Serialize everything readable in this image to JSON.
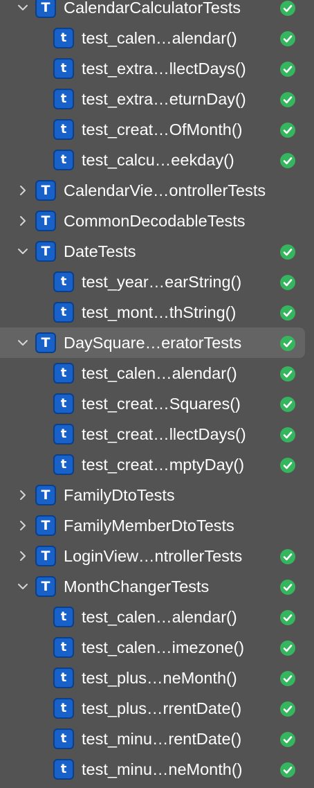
{
  "colors": {
    "background": "#535353",
    "selected_row": "#646464",
    "badge_fill": "#1761c9",
    "pass_green": "#36b55f"
  },
  "items": [
    {
      "kind": "case",
      "label": "CalendarCalculatorTests",
      "expanded": true,
      "passed": true
    },
    {
      "kind": "method",
      "label": "test_calen…alendar()",
      "passed": true
    },
    {
      "kind": "method",
      "label": "test_extra…llectDays()",
      "passed": true
    },
    {
      "kind": "method",
      "label": "test_extra…eturnDay()",
      "passed": true
    },
    {
      "kind": "method",
      "label": "test_creat…OfMonth()",
      "passed": true
    },
    {
      "kind": "method",
      "label": "test_calcu…eekday()",
      "passed": true
    },
    {
      "kind": "case",
      "label": "CalendarVie…ontrollerTests",
      "expanded": false,
      "passed": false
    },
    {
      "kind": "case",
      "label": "CommonDecodableTests",
      "expanded": false,
      "passed": false
    },
    {
      "kind": "case",
      "label": "DateTests",
      "expanded": true,
      "passed": true
    },
    {
      "kind": "method",
      "label": "test_year…earString()",
      "passed": true
    },
    {
      "kind": "method",
      "label": "test_mont…thString()",
      "passed": true
    },
    {
      "kind": "case",
      "label": "DaySquare…eratorTests",
      "expanded": true,
      "passed": true,
      "selected": true
    },
    {
      "kind": "method",
      "label": "test_calen…alendar()",
      "passed": true
    },
    {
      "kind": "method",
      "label": "test_creat…Squares()",
      "passed": true
    },
    {
      "kind": "method",
      "label": "test_creat…llectDays()",
      "passed": true
    },
    {
      "kind": "method",
      "label": "test_creat…mptyDay()",
      "passed": true
    },
    {
      "kind": "case",
      "label": "FamilyDtoTests",
      "expanded": false,
      "passed": false
    },
    {
      "kind": "case",
      "label": "FamilyMemberDtoTests",
      "expanded": false,
      "passed": false
    },
    {
      "kind": "case",
      "label": "LoginView…ntrollerTests",
      "expanded": false,
      "passed": true
    },
    {
      "kind": "case",
      "label": "MonthChangerTests",
      "expanded": true,
      "passed": true
    },
    {
      "kind": "method",
      "label": "test_calen…alendar()",
      "passed": true
    },
    {
      "kind": "method",
      "label": "test_calen…imezone()",
      "passed": true
    },
    {
      "kind": "method",
      "label": "test_plus…neMonth()",
      "passed": true
    },
    {
      "kind": "method",
      "label": "test_plus…rrentDate()",
      "passed": true
    },
    {
      "kind": "method",
      "label": "test_minu…rentDate()",
      "passed": true
    },
    {
      "kind": "method",
      "label": "test_minu…neMonth()",
      "passed": true
    }
  ],
  "badge_letter": "T",
  "method_badge_letter": "t",
  "status_icon": "checkmark-circle-icon",
  "disclosure_icon": "chevron-icon"
}
